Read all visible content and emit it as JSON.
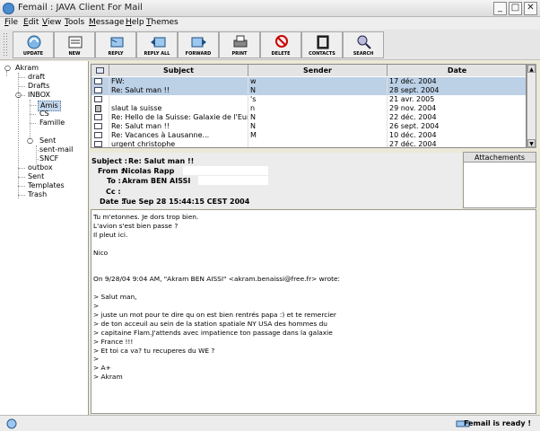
{
  "window": {
    "title": "Femail : JAVA Client For Mail",
    "minimize": "_",
    "maximize": "□",
    "close": "✕"
  },
  "menu": [
    "File",
    "Edit",
    "View",
    "Tools",
    "Message",
    "Help",
    "Themes"
  ],
  "toolbar": [
    {
      "label": "UPDATE",
      "icon": "update-icon"
    },
    {
      "label": "NEW",
      "icon": "new-icon"
    },
    {
      "label": "REPLY",
      "icon": "reply-icon"
    },
    {
      "label": "REPLY ALL",
      "icon": "reply-all-icon"
    },
    {
      "label": "FORWARD",
      "icon": "forward-icon"
    },
    {
      "label": "PRINT",
      "icon": "print-icon"
    },
    {
      "label": "DELETE",
      "icon": "delete-icon"
    },
    {
      "label": "CONTACTS",
      "icon": "contacts-icon"
    },
    {
      "label": "SEARCH",
      "icon": "search-icon"
    }
  ],
  "tree": {
    "root": "Akram",
    "folders": [
      "draft",
      "Drafts",
      "INBOX",
      "Amis",
      "CS",
      "Famille",
      "Sent",
      "sent-mail",
      "SNCF",
      "outbox",
      "Sent",
      "Templates",
      "Trash"
    ],
    "selected": "Amis"
  },
  "table": {
    "columns": [
      "Subject",
      "Sender",
      "Date"
    ],
    "rows": [
      {
        "subject": "FW:",
        "sender": "w",
        "date": "17 déc. 2004",
        "icon": "envelope",
        "selected": true
      },
      {
        "subject": "Re: Salut man !!",
        "sender": "N",
        "date": "28 sept. 2004",
        "icon": "envelope",
        "selected": true
      },
      {
        "subject": "",
        "sender": "'s",
        "date": "21 avr. 2005",
        "icon": "envelope",
        "selected": false
      },
      {
        "subject": "slaut la suisse",
        "sender": "n",
        "date": "29 nov. 2004",
        "icon": "lock",
        "selected": false
      },
      {
        "subject": "Re: Hello de la Suisse: Galaxie de l'Europe...",
        "sender": "N",
        "date": "22 déc. 2004",
        "icon": "envelope",
        "selected": false
      },
      {
        "subject": "Re: Salut man !!",
        "sender": "N",
        "date": "26 sept. 2004",
        "icon": "envelope",
        "selected": false
      },
      {
        "subject": "Re: Vacances à Lausanne...",
        "sender": "M",
        "date": "10 déc. 2004",
        "icon": "envelope",
        "selected": false
      },
      {
        "subject": "urgent christophe",
        "sender": "",
        "date": "27 déc. 2004",
        "icon": "envelope",
        "selected": false
      }
    ]
  },
  "header": {
    "subject_label": "Subject :",
    "subject": "Re: Salut man !!",
    "from_label": "From :",
    "from": "Nicolas Rapp",
    "to_label": "To :",
    "to": "Akram BEN AISSI",
    "cc_label": "Cc :",
    "cc": "",
    "date_label": "Date :",
    "date": "Tue Sep 28 15:44:15 CEST 2004"
  },
  "attachments_label": "Attachements",
  "body_lines": [
    "Tu m'etonnes. Je dors trop bien.",
    "L'avion s'est bien passe ?",
    "Il pleut ici.",
    "",
    "Nico",
    "",
    "",
    "On 9/28/04 9:04 AM, \"Akram BEN AISSI\" <akram.benaissi@free.fr> wrote:",
    "",
    "> Salut man,",
    ">",
    "> juste un mot pour te dire qu on est bien rentrés papa :) et te remercier",
    "> de ton acceuil au sein de la station spatiale NY USA des hommes du",
    "> capitaine Flam.J'attends avec impatience ton passage dans la galaxie",
    "> France !!!",
    "> Et toi ca va? tu recuperes du WE ?",
    ">",
    "> A+",
    "> Akram"
  ],
  "status": "Femail is ready !"
}
